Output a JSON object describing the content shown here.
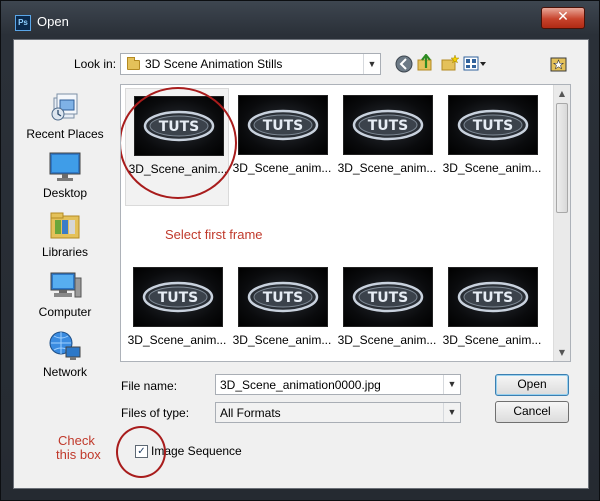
{
  "window": {
    "title": "Open",
    "app_icon_label": "Ps",
    "close_glyph": "✕"
  },
  "look_in": {
    "label": "Look in:",
    "value": "3D Scene Animation Stills",
    "arrow": "▼"
  },
  "toolbar": [
    {
      "name": "back-icon"
    },
    {
      "name": "up-folder-icon"
    },
    {
      "name": "new-folder-icon"
    },
    {
      "name": "view-menu-icon"
    },
    {
      "name": "favorite-folder-icon"
    }
  ],
  "places": [
    {
      "name": "recent-places",
      "label": "Recent Places",
      "icon": "recent-places-icon"
    },
    {
      "name": "desktop",
      "label": "Desktop",
      "icon": "desktop-icon"
    },
    {
      "name": "libraries",
      "label": "Libraries",
      "icon": "libraries-icon"
    },
    {
      "name": "computer",
      "label": "Computer",
      "icon": "computer-icon"
    },
    {
      "name": "network",
      "label": "Network",
      "icon": "network-icon"
    }
  ],
  "files": [
    {
      "caption": "3D_Scene_anim...",
      "thumb_text": "TUTS",
      "selected": true
    },
    {
      "caption": "3D_Scene_anim...",
      "thumb_text": "TUTS"
    },
    {
      "caption": "3D_Scene_anim...",
      "thumb_text": "TUTS"
    },
    {
      "caption": "3D_Scene_anim...",
      "thumb_text": "TUTS"
    },
    {
      "caption": "3D_Scene_anim...",
      "thumb_text": "TUTS"
    },
    {
      "caption": "3D_Scene_anim...",
      "thumb_text": "TUTS"
    },
    {
      "caption": "3D_Scene_anim...",
      "thumb_text": "TUTS"
    },
    {
      "caption": "3D_Scene_anim...",
      "thumb_text": "TUTS"
    }
  ],
  "annotations": {
    "select_first_frame": "Select first frame",
    "check_line1": "Check",
    "check_line2": "this box",
    "color": "#c0392b"
  },
  "file_name": {
    "label": "File name:",
    "value": "3D_Scene_animation0000.jpg",
    "arrow": "▼"
  },
  "files_of_type": {
    "label": "Files of type:",
    "value": "All Formats",
    "arrow": "▼"
  },
  "buttons": {
    "open": "Open",
    "cancel": "Cancel"
  },
  "image_sequence": {
    "label": "Image Sequence",
    "checked": true,
    "check_glyph": "✓"
  },
  "scrollbar": {
    "up_glyph": "▲",
    "down_glyph": "▼"
  }
}
